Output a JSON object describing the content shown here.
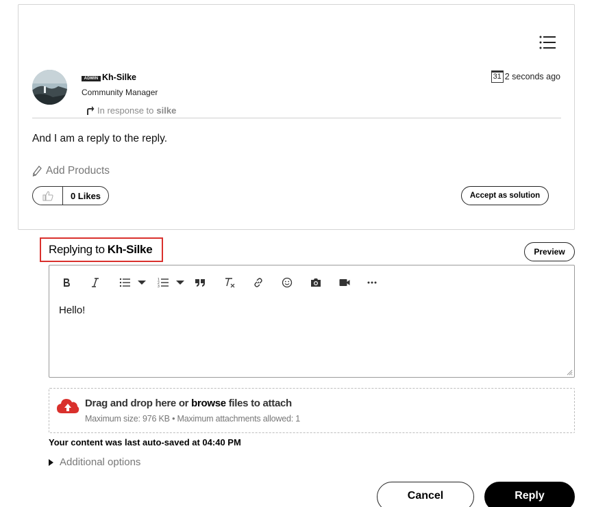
{
  "post": {
    "badge": "ADMIN",
    "author": "Kh-Silke",
    "role": "Community Manager",
    "in_response_prefix": "In response to",
    "in_response_user": "silke",
    "calendar_day": "31",
    "timestamp": "2 seconds ago",
    "body": "And I am a reply to the reply.",
    "add_products": "Add Products",
    "likes": "0 Likes",
    "accept_solution": "Accept as solution"
  },
  "reply": {
    "replying_to_prefix": "Replying to",
    "replying_to_user": "Kh-Silke",
    "preview": "Preview",
    "editor_text": "Hello!",
    "toolbar_icons": [
      "bold-icon",
      "italic-icon",
      "bullet-list-icon",
      "numbered-list-icon",
      "quote-icon",
      "clear-format-icon",
      "link-icon",
      "emoji-icon",
      "camera-icon",
      "video-icon",
      "more-icon"
    ]
  },
  "upload": {
    "prefix": "Drag and drop here or",
    "browse": "browse",
    "suffix": "files to attach",
    "limits": "Maximum size: 976 KB • Maximum attachments allowed: 1"
  },
  "autosave": "Your content was last auto-saved at 04:40 PM",
  "additional_options": "Additional options",
  "actions": {
    "cancel": "Cancel",
    "reply": "Reply"
  },
  "colors": {
    "highlight_border": "#d9302c",
    "upload_icon": "#d9302c",
    "primary_button": "#000000"
  }
}
